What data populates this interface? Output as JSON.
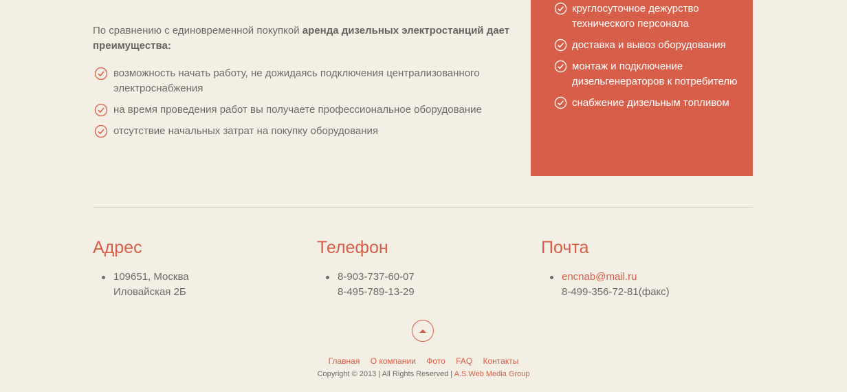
{
  "intro": {
    "lead": "По сравнению с единовременной покупкой ",
    "bold": "аренда дизельных электростанций дает преимущества:"
  },
  "benefits": [
    "возможность начать работу, не дожидаясь подключения централизованного электроснабжения",
    "на время проведения работ вы получаете профессиональное оборудование",
    "отсутствие начальных затрат на покупку оборудования"
  ],
  "services": [
    "круглосуточное дежурство технического персонала",
    "доставка и вывоз оборудования",
    "монтаж и подключение дизельгенераторов к потребителю",
    "снабжение дизельным топливом"
  ],
  "contacts": {
    "address": {
      "title": "Адрес",
      "line1": "109651, Москва",
      "line2": "Иловайская 2Б"
    },
    "phone": {
      "title": "Телефон",
      "line1": "8-903-737-60-07",
      "line2": "8-495-789-13-29"
    },
    "mail": {
      "title": "Почта",
      "email": "encnab@mail.ru",
      "fax": "8-499-356-72-81(факс)"
    }
  },
  "footer": {
    "nav": [
      "Главная",
      "О компании",
      "Фото",
      "FAQ",
      "Контакты"
    ],
    "copyright": "Copyright © 2013 | All Rights Reserved | ",
    "credit": "A.S.Web Media Group"
  },
  "colors": {
    "accent": "#d75f4a",
    "background": "#f3efe4",
    "text": "#6f6a66"
  },
  "icons": {
    "check": "check-circle-icon",
    "up": "arrow-up-icon"
  }
}
